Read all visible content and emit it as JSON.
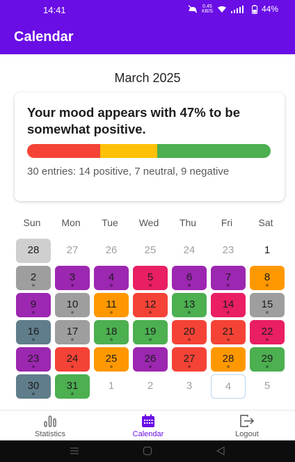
{
  "status_bar": {
    "time": "14:41",
    "net_speed_top": "0.45",
    "net_speed_bottom": "KB/S",
    "battery": "44%"
  },
  "app_bar": {
    "title": "Calendar"
  },
  "calendar": {
    "month_label": "March 2025",
    "weekdays": [
      "Sun",
      "Mon",
      "Tue",
      "Wed",
      "Thu",
      "Fri",
      "Sat"
    ],
    "today": "4",
    "days": [
      [
        {
          "d": "28",
          "c": "#cfcfcf",
          "m": false,
          "dot": false
        },
        {
          "d": "27",
          "c": "",
          "m": true,
          "dot": false
        },
        {
          "d": "26",
          "c": "",
          "m": true,
          "dot": false
        },
        {
          "d": "25",
          "c": "",
          "m": true,
          "dot": false
        },
        {
          "d": "24",
          "c": "",
          "m": true,
          "dot": false
        },
        {
          "d": "23",
          "c": "",
          "m": true,
          "dot": false
        },
        {
          "d": "1",
          "c": "",
          "m": false,
          "dot": false
        }
      ],
      [
        {
          "d": "2",
          "c": "#9e9e9e",
          "m": false,
          "dot": true
        },
        {
          "d": "3",
          "c": "#9c27b0",
          "m": false,
          "dot": true
        },
        {
          "d": "4",
          "c": "#9c27b0",
          "m": false,
          "dot": true
        },
        {
          "d": "5",
          "c": "#e91e63",
          "m": false,
          "dot": true
        },
        {
          "d": "6",
          "c": "#9c27b0",
          "m": false,
          "dot": true
        },
        {
          "d": "7",
          "c": "#9c27b0",
          "m": false,
          "dot": true
        },
        {
          "d": "8",
          "c": "#ff9800",
          "m": false,
          "dot": true
        }
      ],
      [
        {
          "d": "9",
          "c": "#9c27b0",
          "m": false,
          "dot": true
        },
        {
          "d": "10",
          "c": "#9e9e9e",
          "m": false,
          "dot": true
        },
        {
          "d": "11",
          "c": "#ff9800",
          "m": false,
          "dot": true
        },
        {
          "d": "12",
          "c": "#f44336",
          "m": false,
          "dot": true
        },
        {
          "d": "13",
          "c": "#4caf50",
          "m": false,
          "dot": true
        },
        {
          "d": "14",
          "c": "#e91e63",
          "m": false,
          "dot": true
        },
        {
          "d": "15",
          "c": "#9e9e9e",
          "m": false,
          "dot": true
        }
      ],
      [
        {
          "d": "16",
          "c": "#607d8b",
          "m": false,
          "dot": true
        },
        {
          "d": "17",
          "c": "#9e9e9e",
          "m": false,
          "dot": true
        },
        {
          "d": "18",
          "c": "#4caf50",
          "m": false,
          "dot": true
        },
        {
          "d": "19",
          "c": "#4caf50",
          "m": false,
          "dot": true
        },
        {
          "d": "20",
          "c": "#f44336",
          "m": false,
          "dot": true
        },
        {
          "d": "21",
          "c": "#f44336",
          "m": false,
          "dot": true
        },
        {
          "d": "22",
          "c": "#e91e63",
          "m": false,
          "dot": true
        }
      ],
      [
        {
          "d": "23",
          "c": "#9c27b0",
          "m": false,
          "dot": true
        },
        {
          "d": "24",
          "c": "#f44336",
          "m": false,
          "dot": true
        },
        {
          "d": "25",
          "c": "#ff9800",
          "m": false,
          "dot": true
        },
        {
          "d": "26",
          "c": "#9c27b0",
          "m": false,
          "dot": true
        },
        {
          "d": "27",
          "c": "#f44336",
          "m": false,
          "dot": true
        },
        {
          "d": "28",
          "c": "#ff9800",
          "m": false,
          "dot": true
        },
        {
          "d": "29",
          "c": "#4caf50",
          "m": false,
          "dot": true
        }
      ],
      [
        {
          "d": "30",
          "c": "#607d8b",
          "m": false,
          "dot": true
        },
        {
          "d": "31",
          "c": "#4caf50",
          "m": false,
          "dot": true
        },
        {
          "d": "1",
          "c": "",
          "m": true,
          "dot": false
        },
        {
          "d": "2",
          "c": "",
          "m": true,
          "dot": false
        },
        {
          "d": "3",
          "c": "",
          "m": true,
          "dot": false
        },
        {
          "d": "4",
          "c": "",
          "m": true,
          "dot": false
        },
        {
          "d": "5",
          "c": "",
          "m": true,
          "dot": false
        }
      ]
    ]
  },
  "mood_card": {
    "headline": "Your mood appears with 47% to be somewhat positive.",
    "positive_percent": 47,
    "summary": "30 entries: 14 positive, 7 neutral, 9 negative",
    "bar": [
      {
        "name": "negative",
        "fraction": 0.3,
        "color": "#f44336"
      },
      {
        "name": "neutral",
        "fraction": 0.233,
        "color": "#ffc107"
      },
      {
        "name": "positive",
        "fraction": 0.467,
        "color": "#4caf50"
      }
    ]
  },
  "bottom_nav": {
    "items": [
      {
        "label": "Statistics",
        "icon": "bar-chart-icon",
        "active": false
      },
      {
        "label": "Calendar",
        "icon": "calendar-icon",
        "active": true
      },
      {
        "label": "Logout",
        "icon": "logout-icon",
        "active": false
      }
    ]
  },
  "colors": {
    "primary": "#6a0ee6"
  }
}
